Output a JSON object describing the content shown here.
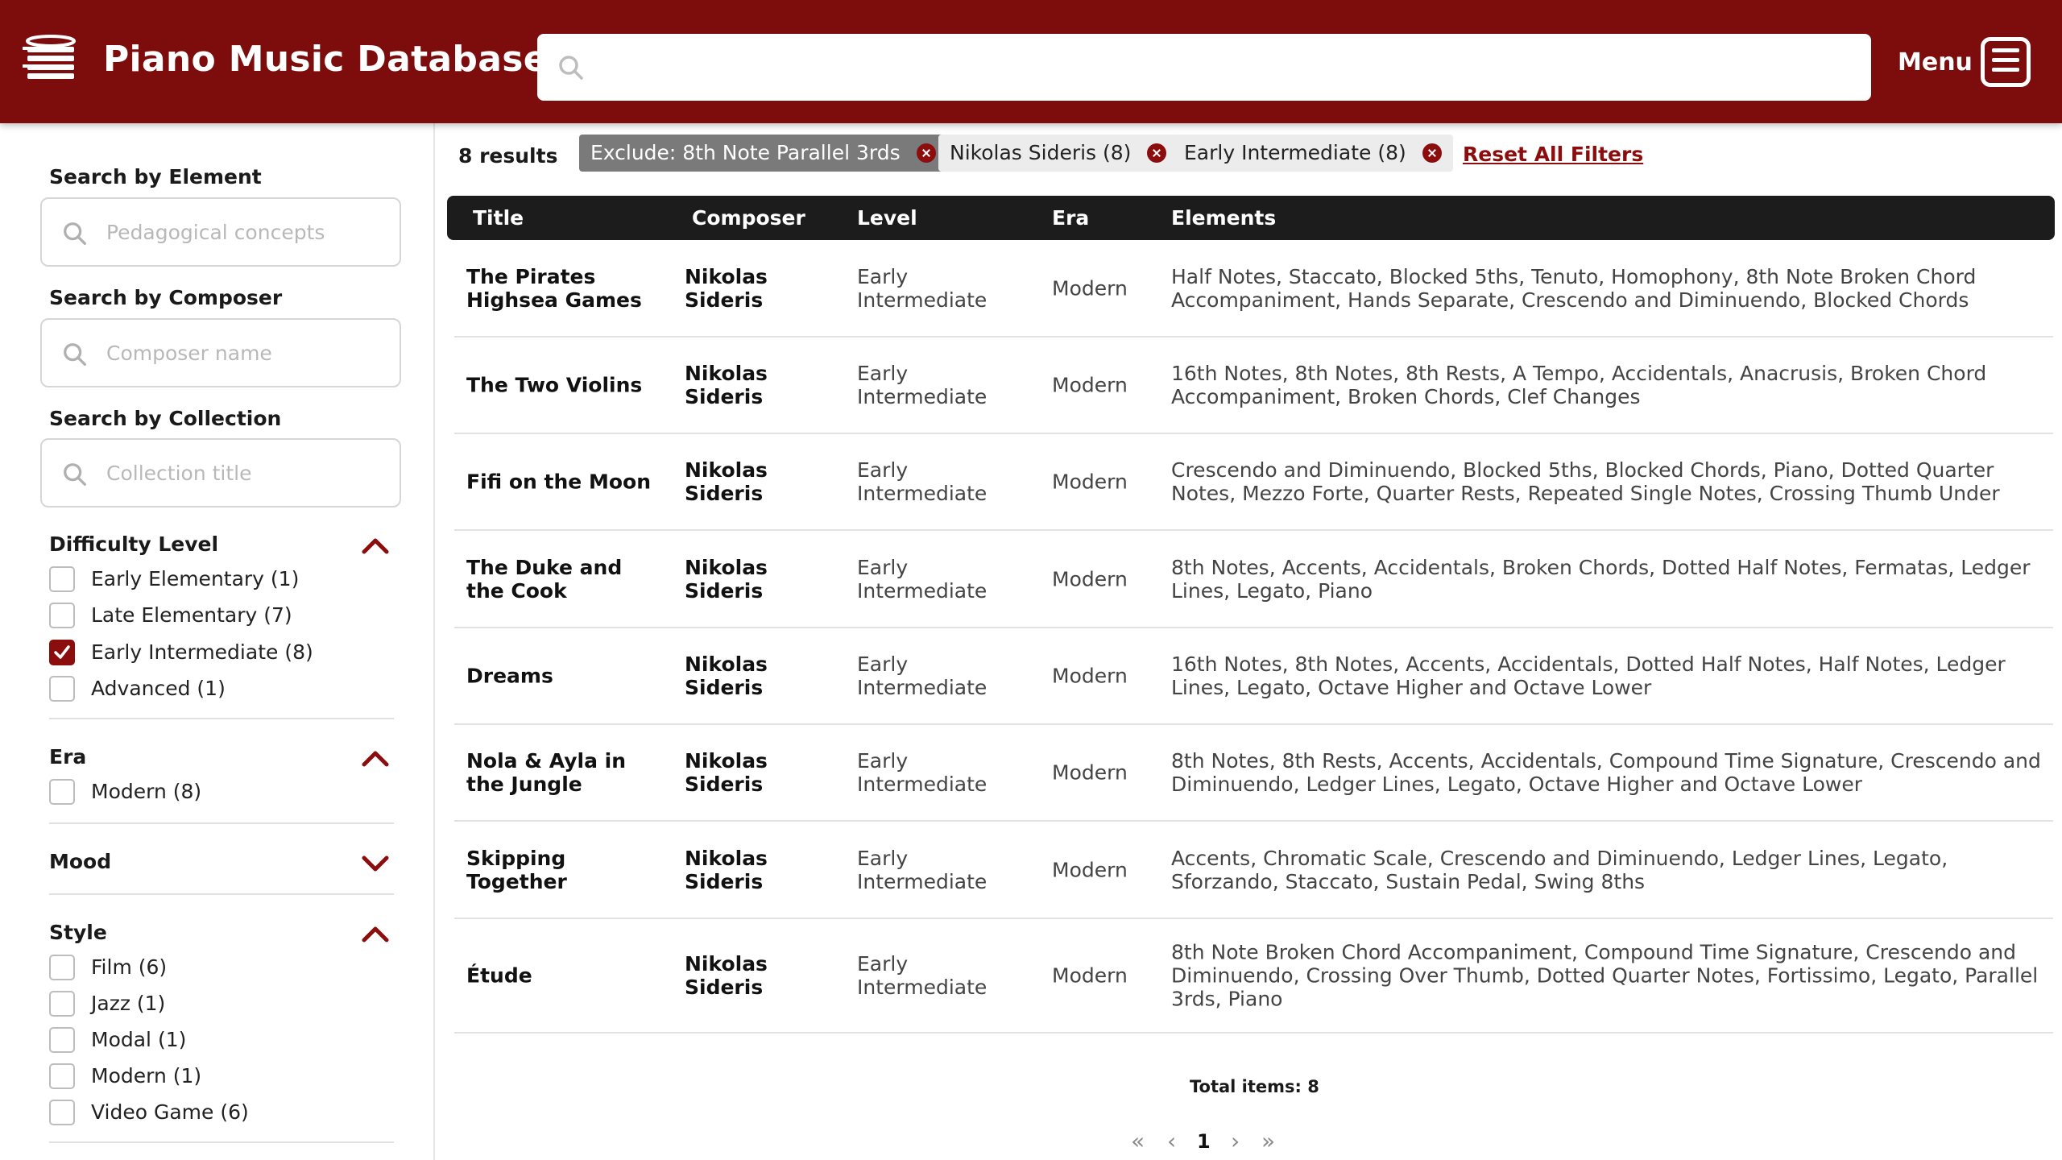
{
  "header": {
    "app_title": "Piano Music Database",
    "search_value": "",
    "menu_label": "Menu"
  },
  "sidebar": {
    "element_label": "Search by Element",
    "element_placeholder": "Pedagogical concepts",
    "composer_label": "Search by Composer",
    "composer_placeholder": "Composer name",
    "collection_label": "Search by Collection",
    "collection_placeholder": "Collection title",
    "facets": {
      "difficulty": {
        "title": "Difficulty Level",
        "expanded": true,
        "options": [
          {
            "label": "Early Elementary (1)",
            "checked": false
          },
          {
            "label": "Late Elementary (7)",
            "checked": false
          },
          {
            "label": "Early Intermediate (8)",
            "checked": true
          },
          {
            "label": "Advanced (1)",
            "checked": false
          }
        ]
      },
      "era": {
        "title": "Era",
        "expanded": true,
        "options": [
          {
            "label": "Modern (8)",
            "checked": false
          }
        ]
      },
      "mood": {
        "title": "Mood",
        "expanded": false
      },
      "style": {
        "title": "Style",
        "expanded": true,
        "options": [
          {
            "label": "Film (6)",
            "checked": false
          },
          {
            "label": "Jazz (1)",
            "checked": false
          },
          {
            "label": "Modal (1)",
            "checked": false
          },
          {
            "label": "Modern (1)",
            "checked": false
          },
          {
            "label": "Video Game (6)",
            "checked": false
          }
        ]
      }
    }
  },
  "results": {
    "count": "8 results",
    "chips": [
      {
        "label": "Exclude: 8th Note Parallel 3rds",
        "style": "dark"
      },
      {
        "label": "Nikolas Sideris (8)",
        "style": "light"
      },
      {
        "label": "Early Intermediate (8)",
        "style": "light"
      }
    ],
    "reset_label": "Reset All Filters"
  },
  "table": {
    "headers": [
      "Title",
      "Composer",
      "Level",
      "Era",
      "Elements"
    ],
    "rows": [
      {
        "title": "The Pirates Highsea Games",
        "composer": "Nikolas Sideris",
        "level": "Early Intermediate",
        "era": "Modern",
        "elements": "Half Notes, Staccato, Blocked 5ths, Tenuto, Homophony, 8th Note Broken Chord Accompaniment, Hands Separate, Crescendo and Diminuendo, Blocked Chords"
      },
      {
        "title": "The Two Violins",
        "composer": "Nikolas Sideris",
        "level": "Early Intermediate",
        "era": "Modern",
        "elements": "16th Notes, 8th Notes, 8th Rests, A Tempo, Accidentals, Anacrusis, Broken Chord Accompaniment, Broken Chords, Clef Changes"
      },
      {
        "title": "Fifi on the Moon",
        "composer": "Nikolas Sideris",
        "level": "Early Intermediate",
        "era": "Modern",
        "elements": "Crescendo and Diminuendo, Blocked 5ths, Blocked Chords, Piano, Dotted Quarter Notes, Mezzo Forte, Quarter Rests, Repeated Single Notes, Crossing Thumb Under"
      },
      {
        "title": "The Duke and the Cook",
        "composer": "Nikolas Sideris",
        "level": "Early Intermediate",
        "era": "Modern",
        "elements": "8th Notes, Accents, Accidentals, Broken Chords, Dotted Half Notes, Fermatas, Ledger Lines, Legato, Piano"
      },
      {
        "title": "Dreams",
        "composer": "Nikolas Sideris",
        "level": "Early Intermediate",
        "era": "Modern",
        "elements": "16th Notes, 8th Notes, Accents, Accidentals, Dotted Half Notes, Half Notes, Ledger Lines, Legato, Octave Higher and Octave Lower"
      },
      {
        "title": "Nola & Ayla in the Jungle",
        "composer": "Nikolas Sideris",
        "level": "Early Intermediate",
        "era": "Modern",
        "elements": "8th Notes, 8th Rests, Accents, Accidentals, Compound Time Signature, Crescendo and Diminuendo, Ledger Lines, Legato, Octave Higher and Octave Lower"
      },
      {
        "title": "Skipping Together",
        "composer": "Nikolas Sideris",
        "level": "Early Intermediate",
        "era": "Modern",
        "elements": "Accents, Chromatic Scale, Crescendo and Diminuendo, Ledger Lines, Legato, Sforzando, Staccato, Sustain Pedal, Swing 8ths"
      },
      {
        "title": "Étude",
        "composer": "Nikolas Sideris",
        "level": "Early Intermediate",
        "era": "Modern",
        "elements": "8th Note Broken Chord Accompaniment, Compound Time Signature, Crescendo and Diminuendo, Crossing Over Thumb, Dotted Quarter Notes, Fortissimo, Legato, Parallel 3rds, Piano"
      }
    ]
  },
  "pagination": {
    "total_label": "Total items: 8",
    "first": "«",
    "prev": "‹",
    "current": "1",
    "next": "›",
    "last": "»"
  },
  "colors": {
    "brand": "#7d0c0c",
    "accent": "#8b0d0d",
    "table_header": "#1c1c1c"
  }
}
